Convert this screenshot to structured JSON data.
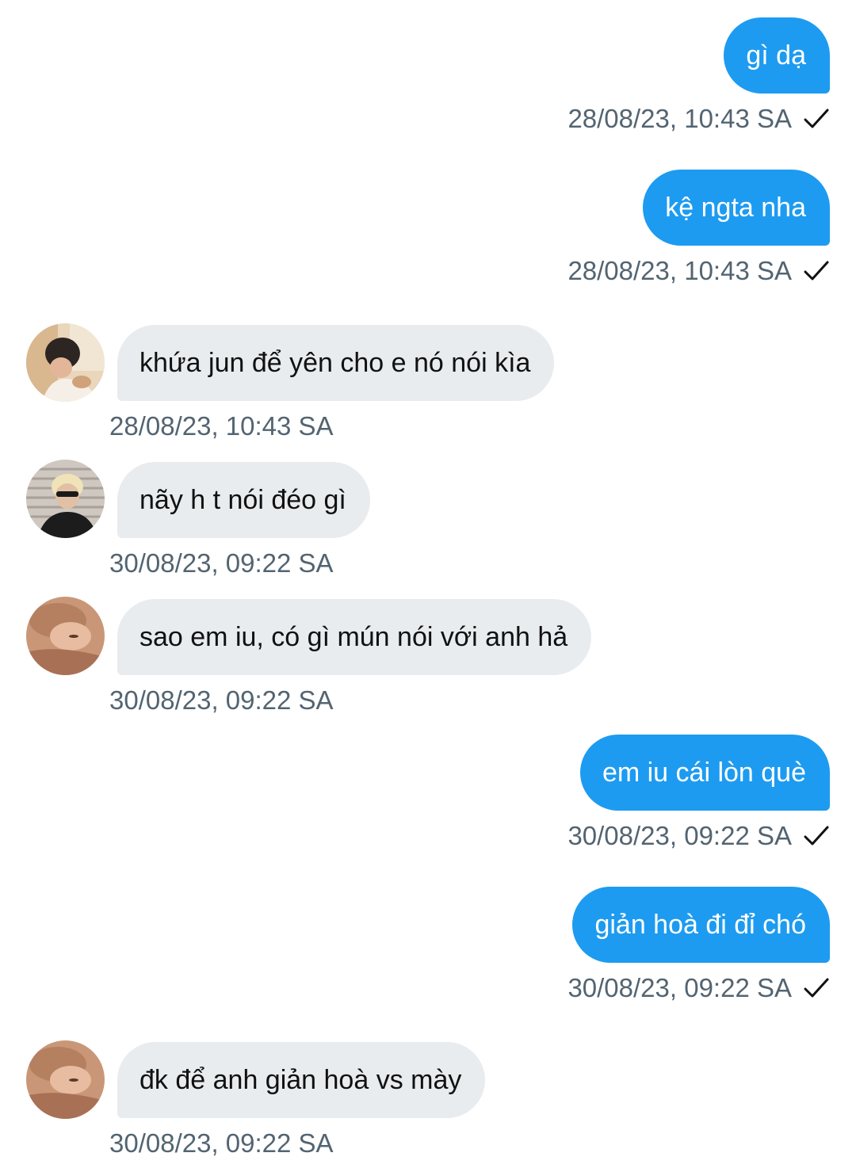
{
  "messages": [
    {
      "side": "out",
      "text": "gì dạ",
      "time": "28/08/23, 10:43 SA"
    },
    {
      "side": "out",
      "text": "kệ ngta nha",
      "time": "28/08/23, 10:43 SA"
    },
    {
      "side": "in",
      "text": "khứa jun để yên cho e nó nói kìa",
      "time": "28/08/23, 10:43 SA",
      "avatar": "user-avatar-dark-hair"
    },
    {
      "side": "in",
      "text": "nãy h t nói đéo gì",
      "time": "30/08/23, 09:22 SA",
      "avatar": "user-avatar-blonde-sunglasses"
    },
    {
      "side": "in",
      "text": "sao em iu, có gì mún nói với anh hả",
      "time": "30/08/23, 09:22 SA",
      "avatar": "user-avatar-lying-down"
    },
    {
      "side": "out",
      "text": "em iu cái lòn què",
      "time": "30/08/23, 09:22 SA"
    },
    {
      "side": "out",
      "text": "giản hoà đi đỉ chó",
      "time": "30/08/23, 09:22 SA"
    },
    {
      "side": "in",
      "text": "đk để anh giản hoà vs mày",
      "time": "30/08/23, 09:22 SA",
      "avatar": "user-avatar-lying-down"
    }
  ],
  "icons": {
    "sent_status": "check-icon"
  },
  "colors": {
    "outgoing_bubble": "#1d9bf0",
    "incoming_bubble": "#e8ecef",
    "timestamp": "#536471"
  }
}
